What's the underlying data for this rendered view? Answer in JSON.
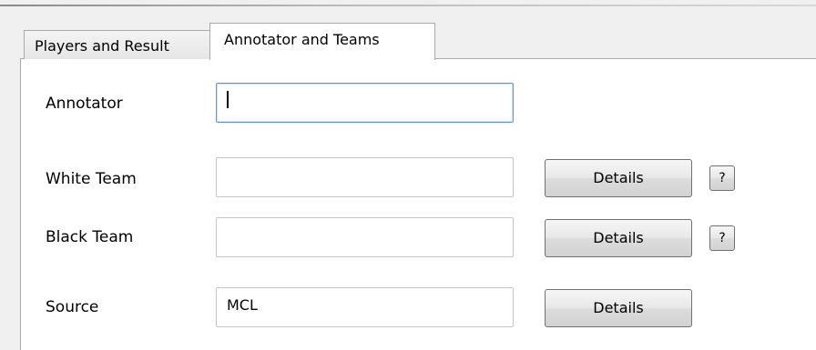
{
  "tabs": [
    {
      "label": "Players and Result",
      "active": false
    },
    {
      "label": "Annotator and Teams",
      "active": true
    }
  ],
  "fields": {
    "annotator": {
      "label": "Annotator",
      "value": ""
    },
    "white_team": {
      "label": "White Team",
      "value": "",
      "details_label": "Details",
      "help_label": "?"
    },
    "black_team": {
      "label": "Black Team",
      "value": "",
      "details_label": "Details",
      "help_label": "?"
    },
    "source": {
      "label": "Source",
      "value": "MCL",
      "details_label": "Details"
    }
  },
  "colors": {
    "window_bg": "#f0f0f0",
    "panel_bg": "#ffffff",
    "focus_border": "#5e9bd6",
    "field_border": "#c5c5c5",
    "button_border": "#707070"
  }
}
